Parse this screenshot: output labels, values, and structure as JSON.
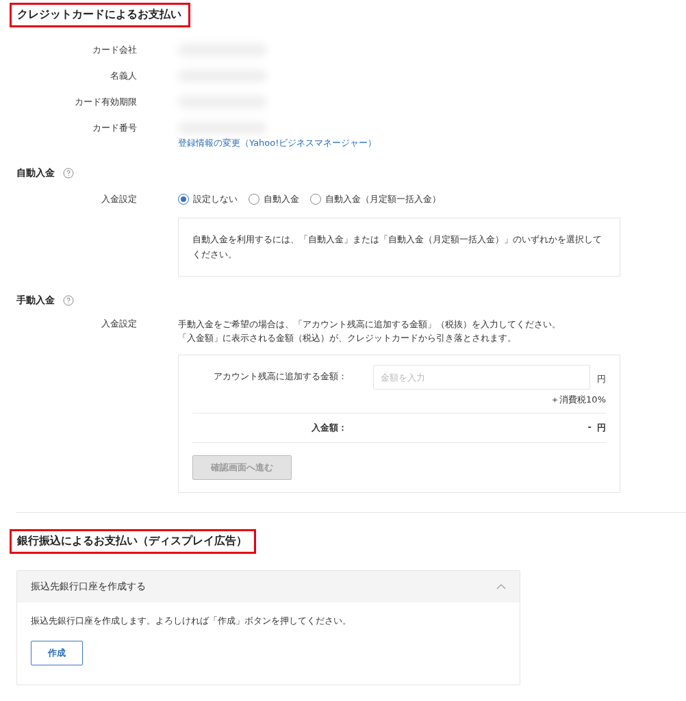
{
  "credit_section": {
    "title": "クレジットカードによるお支払い",
    "highlighted": true,
    "card_fields": [
      {
        "label": "カード会社"
      },
      {
        "label": "名義人"
      },
      {
        "label": "カード有効期限"
      },
      {
        "label": "カード番号"
      }
    ],
    "change_link": "登録情報の変更（Yahoo!ビジネスマネージャー）",
    "auto_deposit": {
      "title": "自動入金",
      "setting_label": "入金設定",
      "options": [
        {
          "label": "設定しない",
          "selected": true
        },
        {
          "label": "自動入金",
          "selected": false
        },
        {
          "label": "自動入金（月定額一括入金）",
          "selected": false
        }
      ],
      "note": "自動入金を利用するには、「自動入金」または「自動入金（月定額一括入金）」のいずれかを選択してください。"
    },
    "manual_deposit": {
      "title": "手動入金",
      "setting_label": "入金設定",
      "description": [
        "手動入金をご希望の場合は、「アカウント残高に追加する金額」（税抜）を入力してください。",
        "「入金額」に表示される金額（税込）が、クレジットカードから引き落とされます。"
      ],
      "amount_label": "アカウント残高に追加する金額：",
      "amount_placeholder": "金額を入力",
      "amount_unit": "円",
      "tax_note": "＋消費税10%",
      "total_label": "入金額：",
      "total_value": "-",
      "total_unit": "円",
      "confirm_button": {
        "label": "確認画面へ進む",
        "disabled": true
      }
    }
  },
  "bank_section": {
    "title": "銀行振込によるお支払い（ディスプレイ広告）",
    "highlighted": true,
    "accordion": {
      "title": "振込先銀行口座を作成する",
      "expanded": true,
      "message": "振込先銀行口座を作成します。よろしければ「作成」ボタンを押してください。",
      "button": "作成"
    }
  }
}
